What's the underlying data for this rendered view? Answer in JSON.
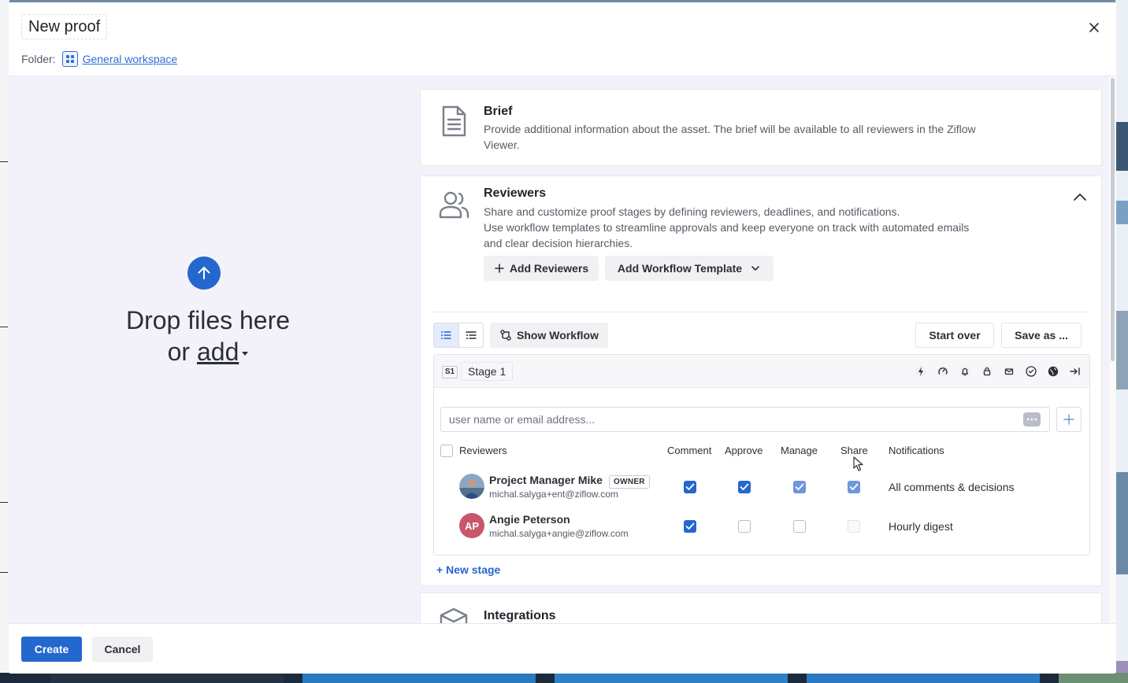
{
  "modal": {
    "title": "New proof",
    "folder_label": "Folder:",
    "folder_name": "General workspace"
  },
  "dropzone": {
    "line1": "Drop files here",
    "line2_prefix": "or",
    "add_label": "add"
  },
  "brief": {
    "title": "Brief",
    "description": "Provide additional information about the asset. The brief will be available to all reviewers in the Ziflow Viewer."
  },
  "reviewers": {
    "title": "Reviewers",
    "description_line1": "Share and customize proof stages by defining reviewers, deadlines, and notifications.",
    "description_line2": "Use workflow templates to streamline approvals and keep everyone on track with automated emails and clear decision hierarchies.",
    "add_reviewers_label": "Add Reviewers",
    "add_template_label": "Add Workflow Template",
    "show_workflow_label": "Show Workflow",
    "start_over_label": "Start over",
    "save_as_label": "Save as ...",
    "stage": {
      "badge": "S1",
      "name": "Stage 1"
    },
    "input_placeholder": "user name or email address...",
    "columns": {
      "reviewers": "Reviewers",
      "comment": "Comment",
      "approve": "Approve",
      "manage": "Manage",
      "share": "Share",
      "notifications": "Notifications"
    },
    "rows": [
      {
        "name": "Project Manager Mike",
        "badge": "OWNER",
        "email": "michal.salyga+ent@ziflow.com",
        "comment": true,
        "approve": true,
        "manage": true,
        "share": true,
        "notifications": "All comments & decisions"
      },
      {
        "name": "Angie Peterson",
        "initials": "AP",
        "email": "michal.salyga+angie@ziflow.com",
        "comment": true,
        "approve": false,
        "manage": false,
        "share": false,
        "notifications": "Hourly digest"
      }
    ],
    "new_stage_label": "New stage"
  },
  "integrations": {
    "title": "Integrations"
  },
  "footer": {
    "create_label": "Create",
    "cancel_label": "Cancel"
  },
  "colors": {
    "primary": "#2467cf",
    "avatar_ap": "#c9566a"
  }
}
